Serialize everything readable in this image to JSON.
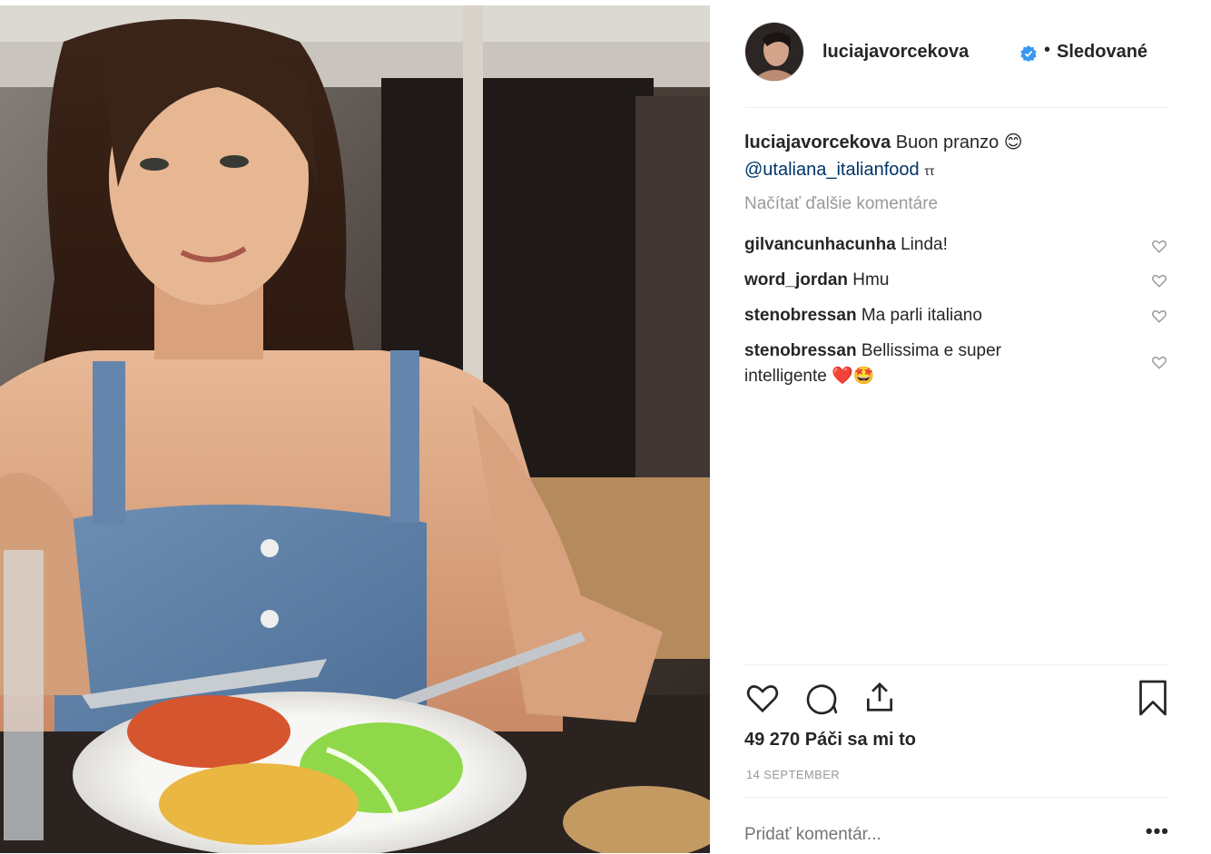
{
  "post": {
    "image_alt": "Woman in denim dress eating lunch at restaurant",
    "user": {
      "username": "luciajavorcekova",
      "verified": true,
      "follow_separator": "•",
      "follow_status": "Sledované"
    },
    "caption": {
      "username": "luciajavorcekova",
      "text": "Buon pranzo",
      "emoji": "😊",
      "mention": "@utaliana_italianfood",
      "suffix_mark": "ττ"
    },
    "load_more_label": "Načítať ďalšie komentáre",
    "comments": [
      {
        "username": "gilvancunhacunha",
        "text": "Linda!"
      },
      {
        "username": "word_jordan",
        "text": "Hmu"
      },
      {
        "username": "stenobressan",
        "text": "Ma parli italiano"
      },
      {
        "username": "stenobressan",
        "text": "Bellissima e super intelligente",
        "emoji": "❤️🤩"
      }
    ],
    "likes_label": "49 270 Páči sa mi to",
    "date": "14 SEPTEMBER",
    "add_comment_placeholder": "Pridať komentár...",
    "more_label": "•••"
  },
  "icons": {
    "like": "heart-icon",
    "comment": "comment-icon",
    "share": "share-icon",
    "save": "bookmark-icon",
    "verified": "verified-badge-icon"
  },
  "colors": {
    "verified": "#3897f0",
    "mention": "#003569",
    "muted": "#999999",
    "text": "#262626"
  }
}
